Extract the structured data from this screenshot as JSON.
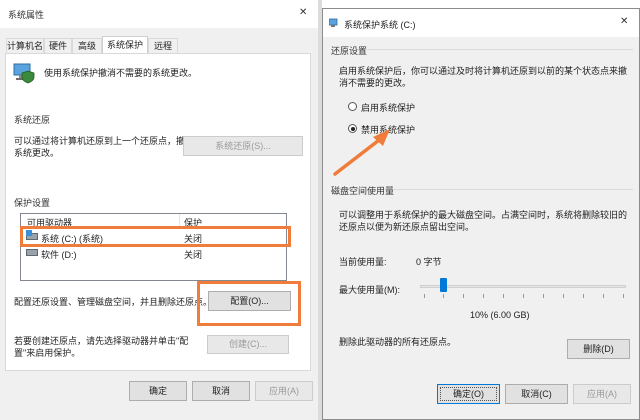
{
  "left": {
    "title": "系统属性",
    "close_glyph": "✕",
    "tabs": [
      "计算机名",
      "硬件",
      "高级",
      "系统保护",
      "远程"
    ],
    "intro_text": "使用系统保护撤消不需要的系统更改。",
    "restore_section": "系统还原",
    "restore_desc": "可以通过将计算机还原到上一个还原点，撤消系统更改。",
    "restore_button": "系统还原(S)...",
    "protect_section": "保护设置",
    "table_headers": [
      "可用驱动器",
      "保护"
    ],
    "drives": [
      {
        "name": "系统 (C:) (系统)",
        "status": "关闭"
      },
      {
        "name": "软件 (D:)",
        "status": "关闭"
      }
    ],
    "config_desc": "配置还原设置、管理磁盘空间，并且删除还原点。",
    "config_button": "配置(O)...",
    "create_desc": "若要创建还原点，请先选择驱动器并单击\"配置\"来启用保护。",
    "create_button": "创建(C)...",
    "ok": "确定",
    "cancel": "取消",
    "apply": "应用(A)"
  },
  "right": {
    "title": "系统保护系统 (C:)",
    "close_glyph": "✕",
    "restore_settings": "还原设置",
    "restore_desc": "启用系统保护后，你可以通过及时将计算机还原到以前的某个状态点来撤消不需要的更改。",
    "radio_on": "启用系统保护",
    "radio_off": "禁用系统保护",
    "disk_section": "磁盘空间使用量",
    "disk_desc": "可以调整用于系统保护的最大磁盘空间。占满空间时，系统将删除较旧的还原点以便为新还原点留出空间。",
    "current_label": "当前使用量:",
    "current_value": "0 字节",
    "max_label": "最大使用量(M):",
    "slider_value": 0.1,
    "slider_readout": "10% (6.00 GB)",
    "delete_desc": "删除此驱动器的所有还原点。",
    "delete_button": "删除(D)",
    "ok": "确定(O)",
    "cancel": "取消(C)",
    "apply": "应用(A)"
  },
  "highlight_color": "#f07c3c",
  "accent_color": "#0078d7"
}
